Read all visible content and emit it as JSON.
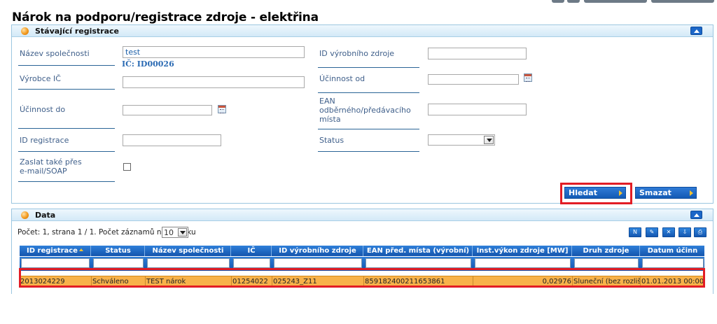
{
  "page": {
    "title": "Nárok na podporu/registrace zdroje - elektřina"
  },
  "search_panel": {
    "title": "Stávající registrace",
    "fields": {
      "company_name_label": "Název společnosti",
      "company_name_value": "test",
      "ic_value": "IČ: ID00026",
      "producer_ic_label": "Výrobce IČ",
      "valid_to_label": "Účinnost do",
      "registration_id_label": "ID registrace",
      "send_email_label": "Zaslat také přes e-mail/SOAP",
      "source_id_label": "ID výrobního zdroje",
      "valid_from_label": "Účinnost od",
      "ean_label": "EAN odběrného/předávacího místa",
      "status_label": "Status"
    },
    "search_button": "Hledat",
    "clear_button": "Smazat"
  },
  "data_panel": {
    "title": "Data",
    "pager_text": "Počet: 1, strana 1 / 1. Počet záznamů na stránku",
    "page_size": "10",
    "columns": [
      "ID registrace",
      "Status",
      "Název společnosti",
      "IČ",
      "ID výrobního zdroje",
      "EAN před. místa (výrobní)",
      "Inst.výkon zdroje [MW]",
      "Druh zdroje",
      "Datum účinn"
    ],
    "rows": [
      [
        "2013024229",
        "Schváleno",
        "TEST nárok",
        "01254022",
        "025243_Z11",
        "859182400211653861",
        "0,02976",
        "Sluneční (bez rozlišení)",
        "01.01.2013 00:00"
      ]
    ]
  },
  "colors": {
    "header_blue": "#1c67c8",
    "highlight_row": "#f8b24a",
    "callout_red": "#e21d25"
  }
}
